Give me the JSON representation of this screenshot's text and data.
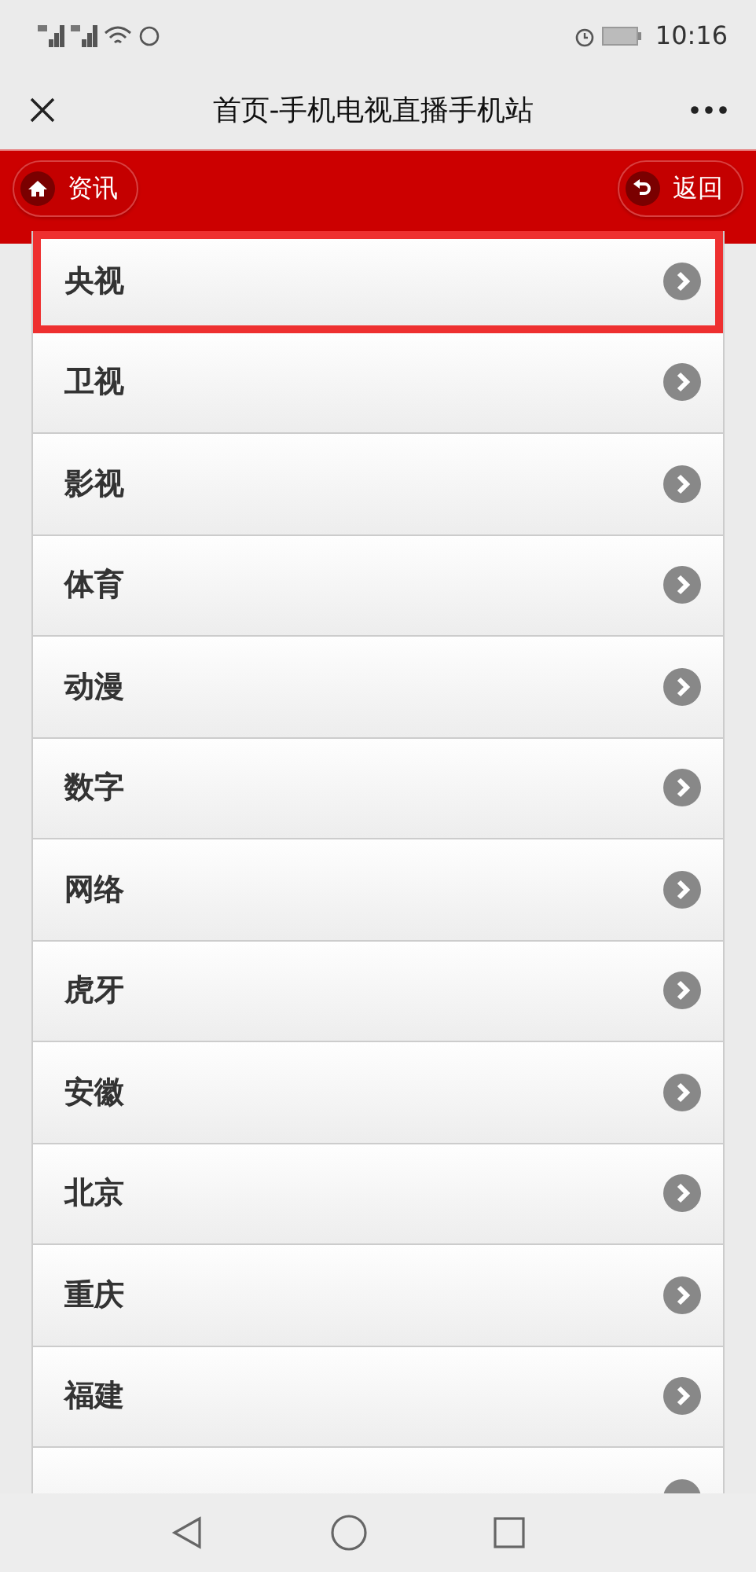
{
  "status_bar": {
    "time": "10:16"
  },
  "title_bar": {
    "title": "首页-手机电视直播手机站"
  },
  "header": {
    "left_button": "资讯",
    "right_button": "返回"
  },
  "list": [
    {
      "label": "央视",
      "highlighted": true
    },
    {
      "label": "卫视",
      "highlighted": false
    },
    {
      "label": "影视",
      "highlighted": false
    },
    {
      "label": "体育",
      "highlighted": false
    },
    {
      "label": "动漫",
      "highlighted": false
    },
    {
      "label": "数字",
      "highlighted": false
    },
    {
      "label": "网络",
      "highlighted": false
    },
    {
      "label": "虎牙",
      "highlighted": false
    },
    {
      "label": "安徽",
      "highlighted": false
    },
    {
      "label": "北京",
      "highlighted": false
    },
    {
      "label": "重庆",
      "highlighted": false
    },
    {
      "label": "福建",
      "highlighted": false
    }
  ]
}
